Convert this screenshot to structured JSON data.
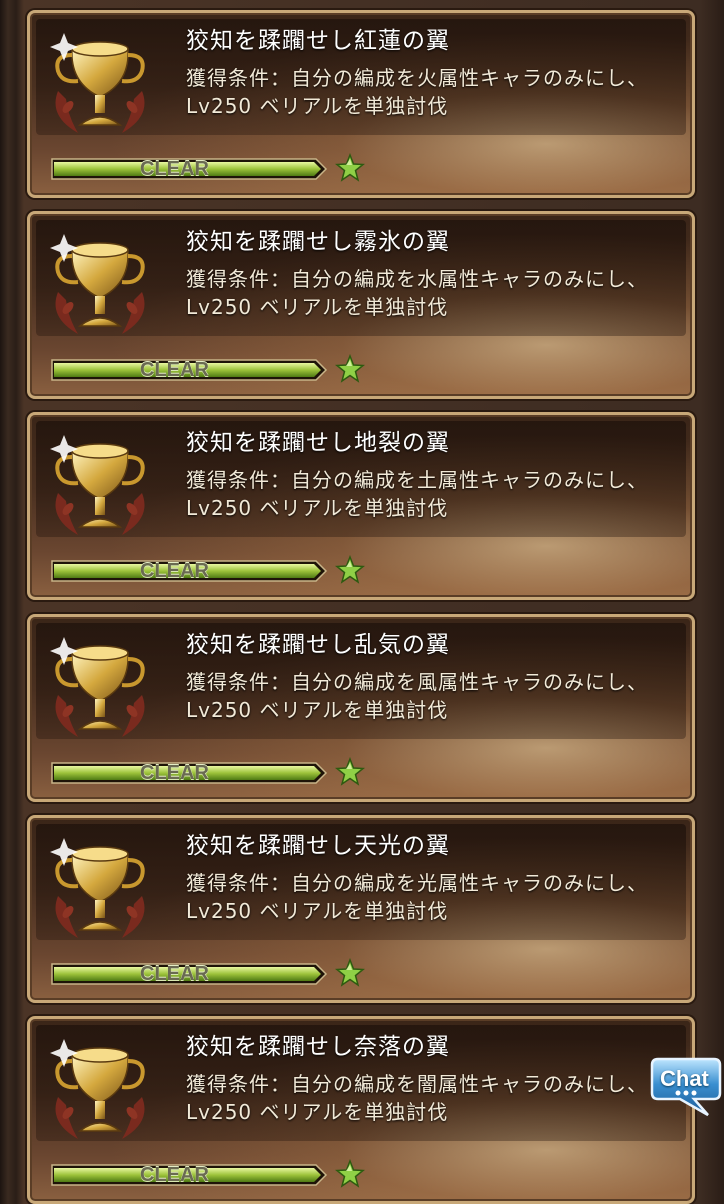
{
  "achievements": [
    {
      "title": "狡知を蹂躙せし紅蓮の翼",
      "condition_line1": "獲得条件：自分の編成を火属性キャラのみにし、",
      "condition_line2": "Lv250 ベリアルを単独討伐",
      "status": "CLEAR"
    },
    {
      "title": "狡知を蹂躙せし霧氷の翼",
      "condition_line1": "獲得条件：自分の編成を水属性キャラのみにし、",
      "condition_line2": "Lv250 ベリアルを単独討伐",
      "status": "CLEAR"
    },
    {
      "title": "狡知を蹂躙せし地裂の翼",
      "condition_line1": "獲得条件：自分の編成を土属性キャラのみにし、",
      "condition_line2": "Lv250 ベリアルを単独討伐",
      "status": "CLEAR"
    },
    {
      "title": "狡知を蹂躙せし乱気の翼",
      "condition_line1": "獲得条件：自分の編成を風属性キャラのみにし、",
      "condition_line2": "Lv250 ベリアルを単独討伐",
      "status": "CLEAR"
    },
    {
      "title": "狡知を蹂躙せし天光の翼",
      "condition_line1": "獲得条件：自分の編成を光属性キャラのみにし、",
      "condition_line2": "Lv250 ベリアルを単独討伐",
      "status": "CLEAR"
    },
    {
      "title": "狡知を蹂躙せし奈落の翼",
      "condition_line1": "獲得条件：自分の編成を闇属性キャラのみにし、",
      "condition_line2": "Lv250 ベリアルを単独討伐",
      "status": "CLEAR"
    }
  ],
  "progress": {
    "value": 1.0
  },
  "icons": {
    "trophy": "gold-trophy-icon",
    "star": "green-star-icon",
    "chat": "chat-bubble-icon"
  },
  "colors": {
    "bar_green": "#9cc23a",
    "gold": "#d9b45a",
    "chat_blue": "#3a8fd0"
  },
  "chat": {
    "label": "Chat"
  }
}
